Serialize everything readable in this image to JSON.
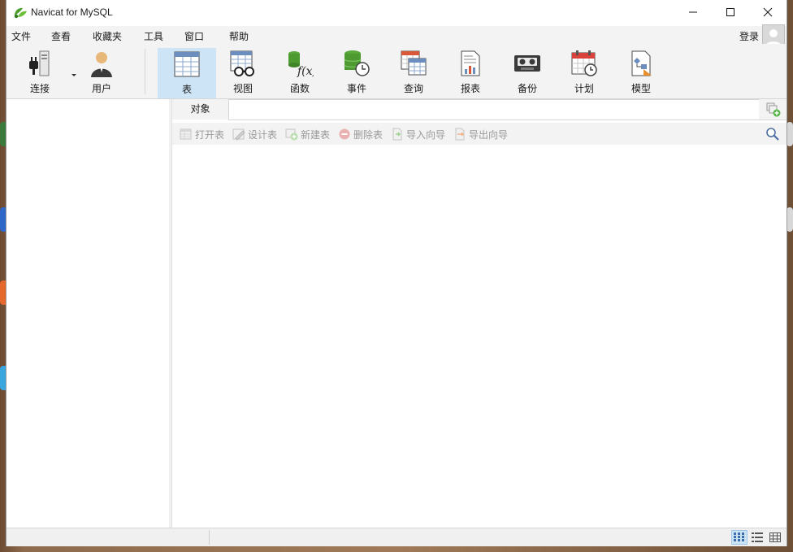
{
  "window": {
    "title": "Navicat for MySQL",
    "accent_color": "#cde4f7",
    "brand_color": "#3f9a2c"
  },
  "menu": {
    "items": [
      "文件",
      "查看",
      "收藏夹",
      "工具",
      "窗口",
      "帮助"
    ],
    "login": "登录"
  },
  "toolbar": {
    "connect": {
      "label": "连接",
      "icon": "plug-server-icon"
    },
    "user": {
      "label": "用户",
      "icon": "user-icon"
    },
    "objects": [
      {
        "label": "表",
        "icon": "table-icon",
        "active": true
      },
      {
        "label": "视图",
        "icon": "view-glasses-icon",
        "active": false
      },
      {
        "label": "函数",
        "icon": "function-icon",
        "active": false
      },
      {
        "label": "事件",
        "icon": "event-clock-icon",
        "active": false
      },
      {
        "label": "查询",
        "icon": "query-icon",
        "active": false
      },
      {
        "label": "报表",
        "icon": "report-icon",
        "active": false
      },
      {
        "label": "备份",
        "icon": "backup-tape-icon",
        "active": false
      },
      {
        "label": "计划",
        "icon": "calendar-icon",
        "active": false
      },
      {
        "label": "模型",
        "icon": "model-icon",
        "active": false
      }
    ]
  },
  "objects_panel": {
    "tab_label": "对象",
    "actions": [
      {
        "label": "打开表",
        "icon": "open-table-icon"
      },
      {
        "label": "设计表",
        "icon": "design-table-icon"
      },
      {
        "label": "新建表",
        "icon": "new-table-icon"
      },
      {
        "label": "删除表",
        "icon": "delete-table-icon"
      },
      {
        "label": "导入向导",
        "icon": "import-wizard-icon"
      },
      {
        "label": "导出向导",
        "icon": "export-wizard-icon"
      }
    ]
  },
  "statusbar": {
    "views": [
      "list-view-icon",
      "detail-view-icon",
      "grid-view-icon"
    ],
    "active_view": "list-view-icon"
  }
}
